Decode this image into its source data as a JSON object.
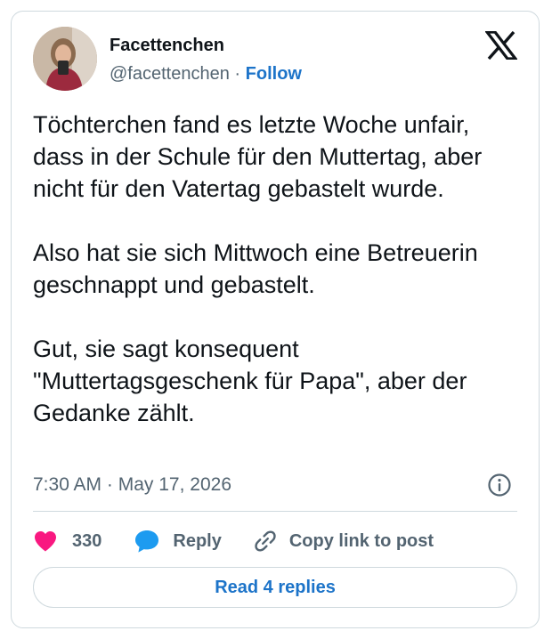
{
  "author": {
    "display_name": "Facettenchen",
    "handle": "@facettenchen",
    "separator": "·",
    "follow_label": "Follow"
  },
  "tweet": {
    "paragraphs": [
      "Töchterchen fand es letzte Woche unfair, dass in der Schule für den Muttertag, aber nicht für den Vatertag gebastelt wurde.",
      "Also hat sie sich Mittwoch eine Betreuerin geschnappt und gebastelt.",
      "Gut, sie sagt konsequent \"Muttertagsgeschenk für Papa\", aber der Gedanke zählt."
    ],
    "time": "7:30 AM",
    "separator": "·",
    "date": "May 17, 2026"
  },
  "actions": {
    "like_count": "330",
    "reply_label": "Reply",
    "copy_link_label": "Copy link to post",
    "read_replies_label": "Read 4 replies"
  },
  "icons": {
    "like": "heart-icon",
    "reply": "speech-bubble-icon",
    "copy": "link-icon",
    "info": "info-icon",
    "brand": "x-logo-icon"
  },
  "colors": {
    "heart": "#f91880",
    "reply_bubble": "#1d9bf0",
    "link_blue": "#1d74c9",
    "muted": "#536471",
    "border": "#cfd9de"
  }
}
